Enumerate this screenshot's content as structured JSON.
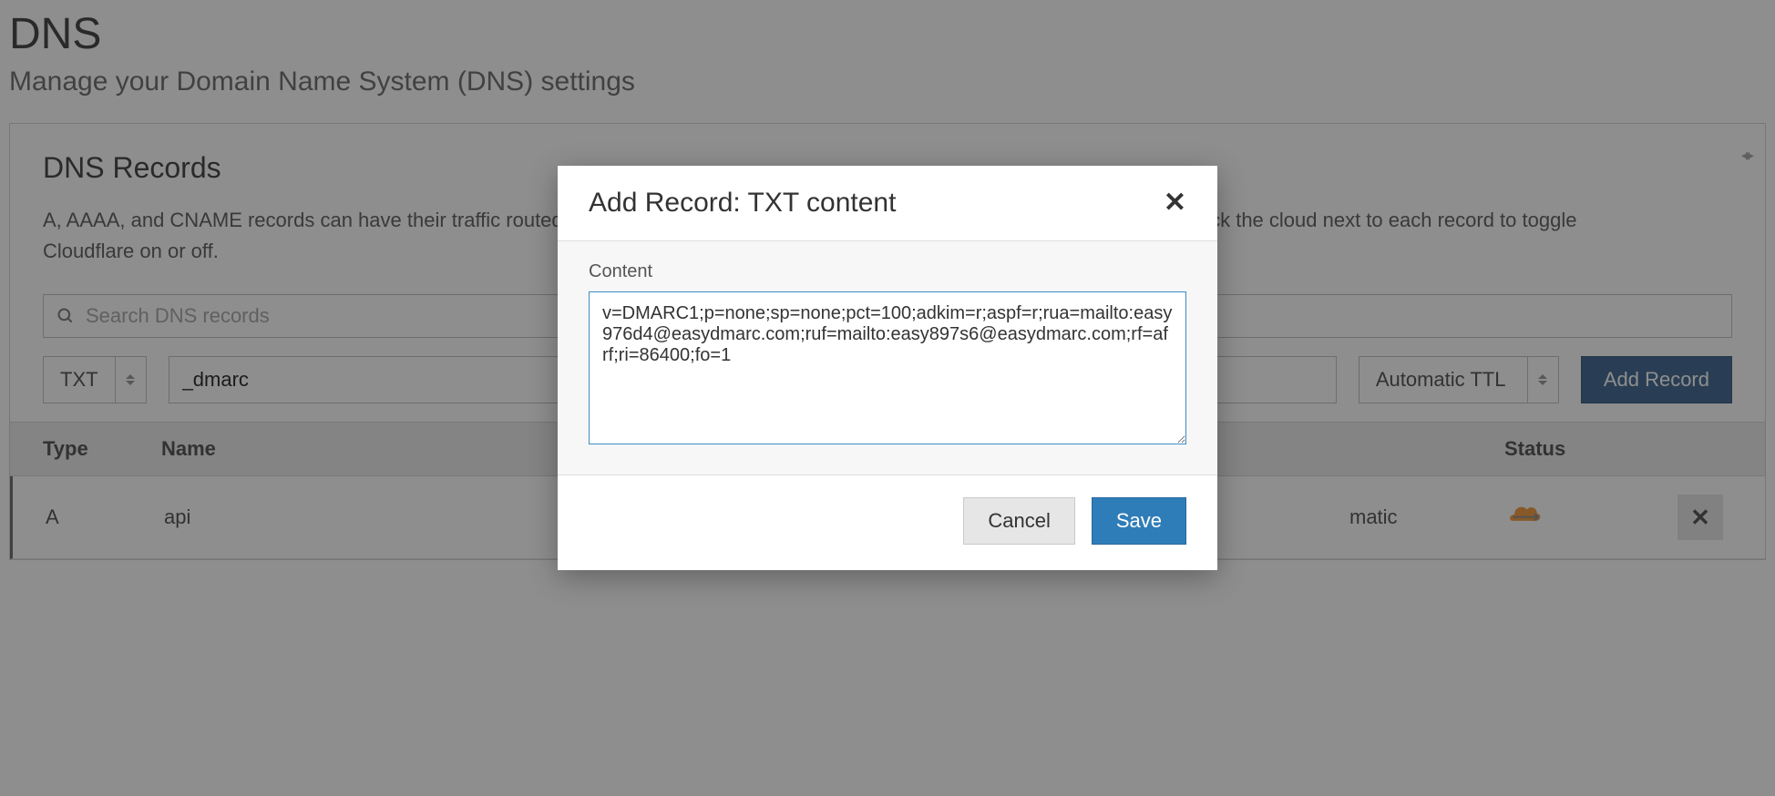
{
  "page": {
    "title": "DNS",
    "subtitle": "Manage your Domain Name System (DNS) settings"
  },
  "records_card": {
    "heading": "DNS Records",
    "description": "A, AAAA, and CNAME records can have their traffic routed through the Cloudflare system. Add more records using this form, and click the cloud next to each record to toggle Cloudflare on or off.",
    "search_placeholder": "Search DNS records",
    "type_select_value": "TXT",
    "name_input_value": "_dmarc",
    "ttl_select_value": "Automatic TTL",
    "add_button_label": "Add Record"
  },
  "table": {
    "headers": {
      "type": "Type",
      "name": "Name",
      "status": "Status"
    },
    "rows": [
      {
        "type": "A",
        "name": "api",
        "ttl_display": "matic",
        "status_icon": "cloud-proxied"
      }
    ]
  },
  "modal": {
    "title": "Add Record: TXT content",
    "content_label": "Content",
    "content_value": "v=DMARC1;p=none;sp=none;pct=100;adkim=r;aspf=r;rua=mailto:easy976d4@easydmarc.com;ruf=mailto:easy897s6@easydmarc.com;rf=afrf;ri=86400;fo=1",
    "cancel_label": "Cancel",
    "save_label": "Save"
  }
}
